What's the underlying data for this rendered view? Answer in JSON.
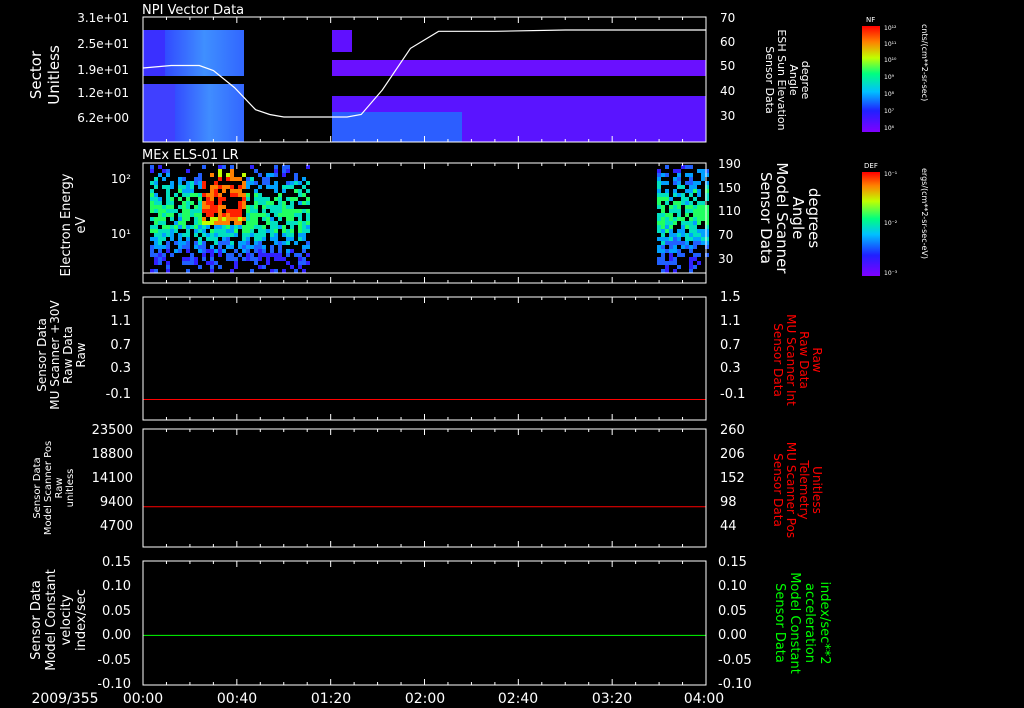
{
  "date_label": "2009/355",
  "time_ticks": [
    "00:00",
    "00:40",
    "01:20",
    "02:00",
    "02:40",
    "03:20",
    "04:00"
  ],
  "colors": {
    "background": "#000000",
    "axis": "#ffffff",
    "red_trace": "#ff0000",
    "green_trace": "#00ff00",
    "gap": "#000000"
  },
  "chart_data": [
    {
      "type": "heatmap",
      "title": "NPI Vector Data",
      "ylabel_left": [
        "Sector",
        "Unitless"
      ],
      "yticks_left": [
        "3.1e+01",
        "2.5e+01",
        "1.9e+01",
        "1.2e+01",
        "6.2e+00"
      ],
      "yticks_right": [
        "70",
        "60",
        "50",
        "40",
        "30"
      ],
      "ylabel_right": [
        "Sensor Data",
        "ESH Sun Elevation",
        "Angle",
        "degree"
      ],
      "colorbar": {
        "label": "NF",
        "unit": "cnts/(cm**2-sr-sec)",
        "ticks": [
          "10¹²",
          "10¹¹",
          "10¹⁰",
          "10⁹",
          "10⁸",
          "10⁷",
          "10⁶"
        ]
      },
      "data_gap_hours": [
        0.87,
        1.55
      ],
      "overlay_line": {
        "name": "ESH Sun Elevation Angle",
        "x_hours": [
          0.0,
          0.2,
          0.4,
          0.5,
          0.65,
          0.8,
          0.9,
          1.0,
          1.2,
          1.45,
          1.55,
          1.7,
          1.9,
          2.1,
          2.5,
          3.0,
          3.5,
          4.0
        ],
        "y_degrees": [
          50,
          51,
          51,
          49,
          42,
          33,
          31,
          30,
          30,
          30,
          31,
          41,
          58,
          65,
          65,
          65.5,
          65.5,
          65.5
        ]
      }
    },
    {
      "type": "heatmap",
      "title": "MEx ELS-01 LR",
      "ylabel_left": [
        "Electron Energy",
        "eV"
      ],
      "yticks_left": [
        "10²",
        "10¹"
      ],
      "yticks_right": [
        "190",
        "150",
        "110",
        "70",
        "30"
      ],
      "ylabel_right": [
        "Sensor Data",
        "Model Scanner",
        "Angle",
        "degrees"
      ],
      "colorbar": {
        "label": "DEF",
        "unit": "ergs/(cm**2-sr-sec-eV)",
        "ticks": [
          "10⁻¹",
          "10⁻²",
          "10⁻³"
        ]
      },
      "data_coverage_hours": [
        [
          0.05,
          1.17
        ],
        [
          3.65,
          4.0
        ]
      ],
      "overlay_line": {
        "name": "Model Scanner Angle",
        "x_hours": [
          0,
          4.0
        ],
        "y_degrees": [
          12,
          12
        ]
      }
    },
    {
      "type": "line",
      "ylabel_left": [
        "Sensor Data",
        "MU Scanner +30V",
        "Raw Data",
        "Raw"
      ],
      "ylabel_right": [
        "Sensor Data",
        "MU Scanner Int",
        "Raw Data",
        "Raw"
      ],
      "yticks_left": [
        "1.5",
        "1.1",
        "0.7",
        "0.3",
        "-0.1"
      ],
      "yticks_right": [
        "1.5",
        "1.1",
        "0.7",
        "0.3",
        "-0.1"
      ],
      "ylim": [
        -0.3,
        1.5
      ],
      "series": [
        {
          "values_x_hours": [
            0,
            4.0
          ],
          "values_y": [
            0.0,
            0.0
          ],
          "color": "#ff0000"
        }
      ]
    },
    {
      "type": "line",
      "ylabel_left": [
        "Sensor Data",
        "Model Scanner Pos",
        "Raw",
        "unitless"
      ],
      "ylabel_right": [
        "Sensor Data",
        "MU Scanner Pos",
        "Telemetry",
        "Unitless"
      ],
      "yticks_left": [
        "23500",
        "18800",
        "14100",
        "9400",
        "4700"
      ],
      "yticks_right": [
        "260",
        "206",
        "152",
        "98",
        "44"
      ],
      "ylim": [
        0,
        23500
      ],
      "series": [
        {
          "values_x_hours": [
            0,
            4.0
          ],
          "values_y": [
            8000,
            8000
          ],
          "color": "#ff0000"
        }
      ]
    },
    {
      "type": "line",
      "ylabel_left": [
        "Sensor Data",
        "Model Constant",
        "velocity",
        "index/sec"
      ],
      "ylabel_right": [
        "Sensor Data",
        "Model Constant",
        "acceleration",
        "index/sec**2"
      ],
      "yticks_left": [
        "0.15",
        "0.10",
        "0.05",
        "0.00",
        "-0.05",
        "-0.10"
      ],
      "yticks_right": [
        "0.15",
        "0.10",
        "0.05",
        "0.00",
        "-0.05",
        "-0.10"
      ],
      "ylim": [
        -0.1,
        0.15
      ],
      "series": [
        {
          "values_x_hours": [
            0,
            4.0
          ],
          "values_y": [
            0.0,
            0.0
          ],
          "color": "#00ff00"
        }
      ]
    }
  ]
}
